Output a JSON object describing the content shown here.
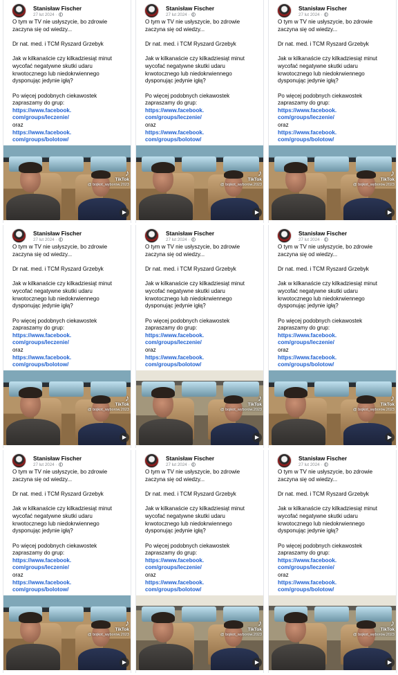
{
  "post": {
    "author": "Stanisław Fischer",
    "date": "27 lut 2024",
    "date_separator": "·",
    "privacy_icon": "globe-icon",
    "line1": "O tym w TV nie usłyszycie, bo zdrowie",
    "line2": "zaczyna się od wiedzy...",
    "line3": "Dr nat. med. i TCM Ryszard Grzebyk",
    "line4": "Jak w kilkanaście czy kilkadziesiąt minut",
    "line5": "wycofać negatywne skutki udaru",
    "line6": "krwotocznego lub niedokrwiennego",
    "line7": "dysponując jedynie igłą?",
    "line8": "Po więcej podobnych ciekawostek",
    "line9": "zapraszamy do grup:",
    "link1a": "https://www.facebook.",
    "link1b": "com/groups/leczenie/",
    "conjunction": "oraz",
    "link2a": "https://www.facebook.",
    "link2b": "com/groups/bolotow/"
  },
  "video": {
    "tiktok_logo": "♪",
    "tiktok_label": "TikTok",
    "tiktok_user": "@ bojkot_wyborow.2023",
    "sound_icon": "speaker-icon"
  },
  "colors": {
    "link": "#1d5fd0",
    "meta": "#8a8d91",
    "text": "#050505"
  }
}
